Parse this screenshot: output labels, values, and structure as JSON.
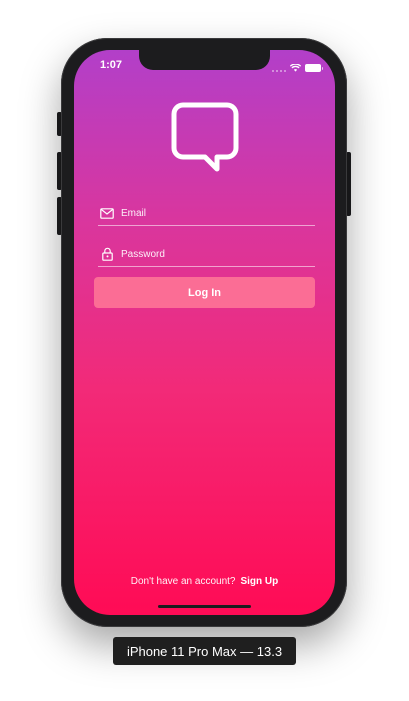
{
  "status_bar": {
    "time": "1:07"
  },
  "app": {
    "logo_icon": "chat-bubble-icon",
    "email_placeholder": "Email",
    "password_placeholder": "Password",
    "login_label": "Log In",
    "signup_prompt": "Don't have an account?",
    "signup_link": "Sign Up",
    "colors": {
      "gradient_top": "#b23fc9",
      "gradient_bottom": "#ff0b55",
      "button_fill": "#ff7896"
    }
  },
  "simulator": {
    "device_label": "iPhone 11 Pro Max — 13.3"
  }
}
